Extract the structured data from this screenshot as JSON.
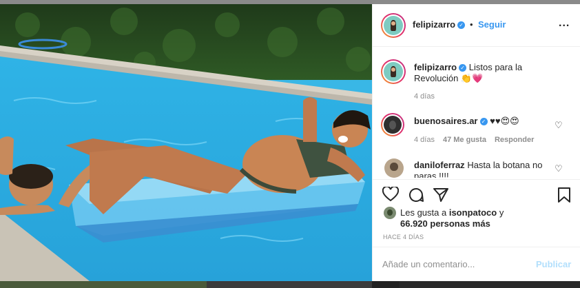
{
  "post": {
    "username": "felipizarro",
    "dot": "•",
    "follow_label": "Seguir",
    "more_label": "...",
    "caption_username": "felipizarro",
    "caption_text": "Listos para la Revolución 👏💗",
    "caption_time": "4 días"
  },
  "comments": [
    {
      "username": "buenosaires.ar",
      "text": "♥♥😍😍",
      "time": "4 días",
      "likes": "47 Me gusta",
      "reply_label": "Responder"
    },
    {
      "username": "daniloferraz",
      "text": "Hasta la botana no paras !!!!"
    }
  ],
  "likes": {
    "prefix": "Les gusta a",
    "user": "isonpatoco",
    "connector": "y",
    "count_text": "66.920 personas más"
  },
  "posted_ago": "HACE 4 DÍAS",
  "comment_box": {
    "placeholder": "Añade un comentario...",
    "publish_label": "Publicar"
  },
  "icons": {
    "verified": "verified-badge-icon",
    "heart": "heart-icon",
    "comment": "comment-icon",
    "share": "share-icon",
    "save": "bookmark-icon",
    "more": "more-options-icon"
  },
  "colors": {
    "link_blue": "#3897f0",
    "publish_disabled": "#b2dffc",
    "muted": "#8e8e8e",
    "text": "#262626"
  }
}
